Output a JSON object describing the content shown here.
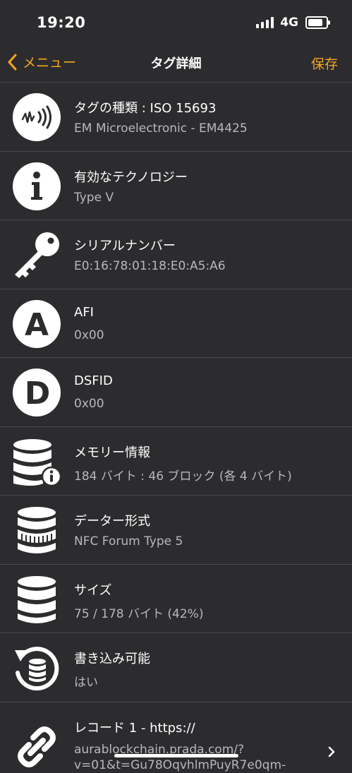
{
  "status": {
    "time": "19:20",
    "network": "4G"
  },
  "nav": {
    "back_label": "メニュー",
    "title": "タグ詳細",
    "save_label": "保存"
  },
  "rows": [
    {
      "title": "タグの種類 : ISO 15693",
      "value": "EM Microelectronic - EM4425",
      "icon": "nfc-tag-icon"
    },
    {
      "title": "有効なテクノロジー",
      "value": "Type V",
      "icon": "info-icon"
    },
    {
      "title": "シリアルナンバー",
      "value": "E0:16:78:01:18:E0:A5:A6",
      "icon": "key-icon"
    },
    {
      "title": "AFI",
      "value": "0x00",
      "icon": "afi-icon"
    },
    {
      "title": "DSFID",
      "value": "0x00",
      "icon": "dsfid-icon"
    },
    {
      "title": "メモリー情報",
      "value": "184 バイト : 46 ブロック (各 4 バイト)",
      "icon": "database-info-icon"
    },
    {
      "title": "データー形式",
      "value": "NFC Forum Type 5",
      "icon": "database-format-icon"
    },
    {
      "title": "サイズ",
      "value": "75 / 178 バイト (42%)",
      "icon": "database-icon"
    },
    {
      "title": "書き込み可能",
      "value": "はい",
      "icon": "writable-icon"
    },
    {
      "title": "レコード 1 - https://",
      "value": "aurablockchain.prada.com/?v=01&t=Gu78OqvhlmPuyR7e0qm-",
      "icon": "link-icon"
    }
  ]
}
